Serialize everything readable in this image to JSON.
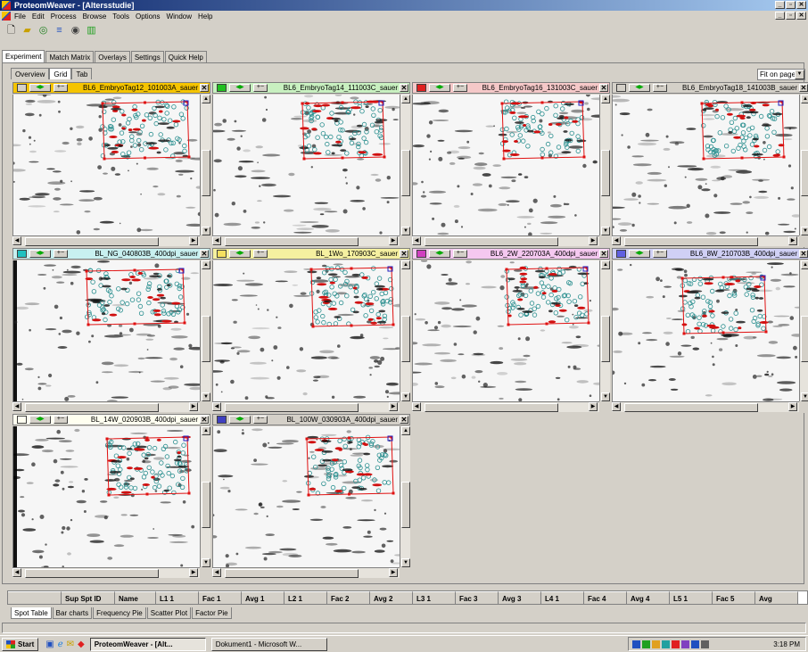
{
  "window": {
    "title": "ProteomWeaver - [Altersstudie]"
  },
  "menu": [
    "File",
    "Edit",
    "Process",
    "Browse",
    "Tools",
    "Options",
    "Window",
    "Help"
  ],
  "toolbar_icons": [
    "new-file-icon",
    "open-folder-icon",
    "spot-detect-icon",
    "matching-icon",
    "eye-icon",
    "bar-chart-icon"
  ],
  "main_tabs": [
    "Experiment",
    "Match Matrix",
    "Overlays",
    "Settings",
    "Quick Help"
  ],
  "view_tabs": [
    "Overview",
    "Grid",
    "Tab"
  ],
  "fit_select": "Fit on page",
  "gels": [
    {
      "name": "BL6_EmbryoTag12_101003A_sauer",
      "color": "#f5c400",
      "swatch": "#d4d0c8"
    },
    {
      "name": "BL6_EmbryoTag14_111003C_sauer",
      "color": "#c8f0c0",
      "swatch": "#20c020"
    },
    {
      "name": "BL6_EmbryoTag16_131003C_sauer",
      "color": "#f5c8c8",
      "swatch": "#e02020"
    },
    {
      "name": "BL6_EmbryoTag18_141003B_sauer",
      "color": "#d4d0c8",
      "swatch": "#d4d0c8"
    },
    {
      "name": "BL_NG_040803B_400dpi_sauer",
      "color": "#c8f0f0",
      "swatch": "#20c0c0"
    },
    {
      "name": "BL_1Wo_170903C_sauer",
      "color": "#f5f0a0",
      "swatch": "#f5e060"
    },
    {
      "name": "BL6_2W_220703A_400dpi_sauer",
      "color": "#f5c8f0",
      "swatch": "#d040c0"
    },
    {
      "name": "BL6_8W_210703B_400dpi_sauer",
      "color": "#d0d0f5",
      "swatch": "#6060e0"
    },
    {
      "name": "BL_14W_020903B_400dpi_sauer",
      "color": "#fffff0",
      "swatch": "#fffff0"
    },
    {
      "name": "BL_100W_030903A_400dpi_sauer",
      "color": "#d4d0c8",
      "swatch": "#4040c0"
    }
  ],
  "spot_table": {
    "columns": [
      "Sup Spt ID",
      "Name",
      "L1 1",
      "Fac 1",
      "Avg 1",
      "L2 1",
      "Fac 2",
      "Avg 2",
      "L3 1",
      "Fac 3",
      "Avg 3",
      "L4 1",
      "Fac 4",
      "Avg 4",
      "L5 1",
      "Fac 5",
      "Avg"
    ]
  },
  "bottom_tabs": [
    "Spot Table",
    "Bar charts",
    "Frequency Pie",
    "Scatter Plot",
    "Factor Pie"
  ],
  "taskbar": {
    "start": "Start",
    "tasks": [
      "ProteomWeaver - [Alt...",
      "Dokument1 - Microsoft W..."
    ],
    "clock": "3:18 PM"
  }
}
